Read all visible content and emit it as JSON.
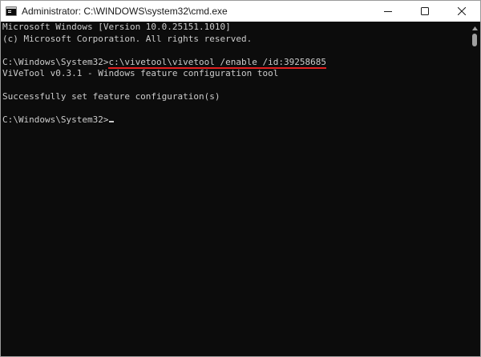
{
  "window": {
    "title": "Administrator: C:\\WINDOWS\\system32\\cmd.exe",
    "icon": "cmd-icon",
    "controls": [
      "minimize-icon",
      "maximize-icon",
      "close-icon"
    ]
  },
  "console": {
    "line1": "Microsoft Windows [Version 10.0.25151.1010]",
    "line2": "(c) Microsoft Corporation. All rights reserved.",
    "prompt1": "C:\\Windows\\System32>",
    "command1": "c:\\vivetool\\vivetool /enable /id:39258685",
    "line4": "ViVeTool v0.3.1 - Windows feature configuration tool",
    "line6": "Successfully set feature configuration(s)",
    "prompt2": "C:\\Windows\\System32>"
  },
  "colors": {
    "console_bg": "#0c0c0c",
    "console_text": "#cccccc",
    "highlight_underline": "#e02020",
    "titlebar_bg": "#ffffff"
  }
}
